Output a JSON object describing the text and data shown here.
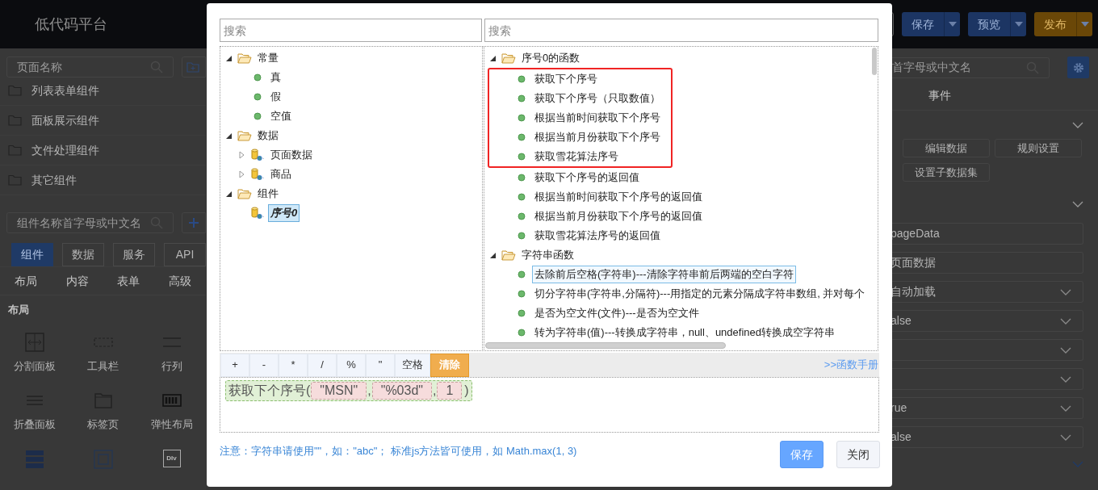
{
  "app": {
    "title": "低代码平台",
    "top_buttons": [
      {
        "label": "保存",
        "kind": "primary"
      },
      {
        "label": "预览",
        "kind": "primary"
      },
      {
        "label": "发布",
        "kind": "warning"
      }
    ],
    "left_panel": {
      "page_search": {
        "placeholder": "页面名称"
      },
      "folders": [
        "列表表单组件",
        "面板展示组件",
        "文件处理组件",
        "其它组件"
      ],
      "component_search": {
        "placeholder": "组件名称首字母或中文名"
      },
      "tabs": [
        {
          "label": "组件",
          "selected": true
        },
        {
          "label": "数据",
          "selected": false
        },
        {
          "label": "服务",
          "selected": false
        },
        {
          "label": "API",
          "selected": false
        }
      ],
      "subtabs": [
        "布局",
        "内容",
        "表单",
        "高级"
      ],
      "section": "布局",
      "components": [
        {
          "label": "分割面板",
          "kind": "split"
        },
        {
          "label": "工具栏",
          "kind": "dashed"
        },
        {
          "label": "行列",
          "kind": "rows"
        },
        {
          "label": "折叠面板",
          "kind": "lines"
        },
        {
          "label": "标签页",
          "kind": "folder"
        },
        {
          "label": "弹性布局",
          "kind": "columns"
        },
        {
          "kind": "stack"
        },
        {
          "kind": "frame"
        },
        {
          "kind": "div",
          "icon_text": "DIv"
        }
      ]
    },
    "right_panel": {
      "search": {
        "placeholder": "首字母或中文名"
      },
      "tab": "事件",
      "buttons": [
        [
          "编辑数据",
          "规则设置"
        ],
        [
          "设置子数据集"
        ]
      ],
      "fields": [
        {
          "value": "pageData",
          "kind": "text"
        },
        {
          "value": "页面数据",
          "kind": "text"
        },
        {
          "value": "自动加载",
          "kind": "select"
        },
        {
          "value": "alse",
          "kind": "select"
        },
        {
          "kind": "select"
        },
        {
          "kind": "select"
        },
        {
          "value": "rue",
          "kind": "select"
        },
        {
          "value": "alse",
          "kind": "select"
        }
      ]
    }
  },
  "dialog": {
    "left_search": {
      "placeholder": "搜索"
    },
    "right_search": {
      "placeholder": "搜索"
    },
    "left_tree": [
      {
        "label": "常量",
        "kind": "folder",
        "expanded": true,
        "selected": false,
        "children": [
          {
            "label": "真",
            "kind": "leaf",
            "selected": false
          },
          {
            "label": "假",
            "kind": "leaf",
            "selected": false
          },
          {
            "label": "空值",
            "kind": "leaf",
            "selected": false
          }
        ]
      },
      {
        "label": "数据",
        "kind": "folder",
        "expanded": true,
        "selected": false,
        "children": [
          {
            "label": "页面数据",
            "kind": "dataset",
            "expanded": false,
            "selected": false
          },
          {
            "label": "商品",
            "kind": "dataset",
            "expanded": false,
            "selected": false
          }
        ]
      },
      {
        "label": "组件",
        "kind": "folder",
        "expanded": true,
        "selected": false,
        "children": [
          {
            "label": "序号0",
            "kind": "dataset",
            "selected": true
          }
        ]
      }
    ],
    "right_tree": [
      {
        "label": "序号0的函数",
        "kind": "folder",
        "expanded": true,
        "selected": false,
        "children": [
          {
            "label": "获取下个序号",
            "kind": "leaf",
            "selected": false,
            "highlighted": true
          },
          {
            "label": "获取下个序号（只取数值）",
            "kind": "leaf",
            "selected": false,
            "highlighted": true
          },
          {
            "label": "根据当前时间获取下个序号",
            "kind": "leaf",
            "selected": false,
            "highlighted": true
          },
          {
            "label": "根据当前月份获取下个序号",
            "kind": "leaf",
            "selected": false,
            "highlighted": true
          },
          {
            "label": "获取雪花算法序号",
            "kind": "leaf",
            "selected": false,
            "highlighted": true
          },
          {
            "label": "获取下个序号的返回值",
            "kind": "leaf",
            "selected": false,
            "highlighted": false
          },
          {
            "label": "根据当前时间获取下个序号的返回值",
            "kind": "leaf",
            "selected": false,
            "highlighted": false
          },
          {
            "label": "根据当前月份获取下个序号的返回值",
            "kind": "leaf",
            "selected": false,
            "highlighted": false
          },
          {
            "label": "获取雪花算法序号的返回值",
            "kind": "leaf",
            "selected": false,
            "highlighted": false
          }
        ]
      },
      {
        "label": "字符串函数",
        "kind": "folder",
        "expanded": true,
        "selected": false,
        "children": [
          {
            "label": "去除前后空格(字符串)---清除字符串前后两端的空白字符",
            "kind": "leaf",
            "selected": true,
            "highlighted": false
          },
          {
            "label": "切分字符串(字符串,分隔符)---用指定的元素分隔成字符串数组, 并对每个",
            "kind": "leaf",
            "selected": false,
            "highlighted": false
          },
          {
            "label": "是否为空文件(文件)---是否为空文件",
            "kind": "leaf",
            "selected": false,
            "highlighted": false
          },
          {
            "label": "转为字符串(值)---转换成字符串，null、undefined转换成空字符串",
            "kind": "leaf",
            "selected": false,
            "highlighted": false
          }
        ]
      }
    ],
    "operators": [
      {
        "label": "+",
        "kind": "operator"
      },
      {
        "label": "-",
        "kind": "operator"
      },
      {
        "label": "*",
        "kind": "operator"
      },
      {
        "label": "/",
        "kind": "operator"
      },
      {
        "label": "%",
        "kind": "operator"
      },
      {
        "label": "\"",
        "kind": "operator"
      },
      {
        "label": "空格",
        "kind": "operator"
      },
      {
        "label": "清除",
        "kind": "clear"
      }
    ],
    "manual_link": ">>函数手册",
    "expression": {
      "function": "获取下个序号",
      "open": "(",
      "separator": ",",
      "close": ")",
      "args": [
        "\"MSN\"",
        "\"%03d\"",
        "1"
      ]
    },
    "notice": "注意：字符串请使用\"\"，如：\"abc\"； 标准js方法皆可使用，如 Math.max(1, 3)",
    "buttons": [
      {
        "label": "保存",
        "kind": "primary"
      },
      {
        "label": "关闭",
        "kind": "default"
      }
    ]
  }
}
